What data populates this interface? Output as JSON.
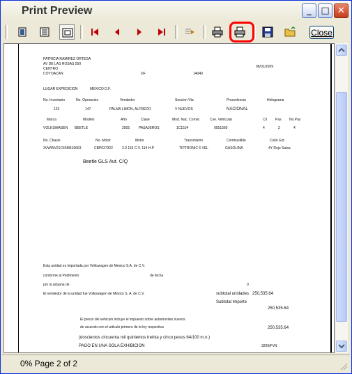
{
  "window": {
    "title": "Print Preview",
    "minimize_glyph": "_",
    "maximize_glyph": "□",
    "close_glyph": "✕"
  },
  "toolbar": {
    "close_label": "Close",
    "buttons": [
      "one-page-view",
      "two-page-view",
      "fit-page",
      "first-page",
      "previous-page",
      "next-page",
      "last-page",
      "go-to-page",
      "printer-setup",
      "print",
      "save",
      "open"
    ]
  },
  "status": {
    "text": "0% Page 2 of 2"
  },
  "document": {
    "name": "PATRICIA RAMIREZ ORTEGA",
    "address1": "AV DE LAS ROSAS 550",
    "address2": "CENTRO",
    "address3": "COYOACAN",
    "state": "DF",
    "zip": "14040",
    "date": "06/01/2009",
    "lugar_label": "LUGAR EXPEDICION",
    "lugar_value": "MEXICO D.F.",
    "headers1": [
      "No. Inventario",
      "No. Operacion",
      "Vendedor",
      "Seccion Vta",
      "Procedencia",
      "Holograma"
    ],
    "values1": [
      "123",
      "147",
      "PALMA LIMON, ALFREDO",
      "V NUEVOS",
      "NACIONAL"
    ],
    "headers2": [
      "Marca",
      "Modelo",
      "Año",
      "Clase",
      "Mod. Nac. Comer.",
      "Cve. Vehicular",
      "Cil",
      "Pas",
      "No.Pas"
    ],
    "values2": [
      "VOLKSWAGEN",
      "BEETLE",
      "2005",
      "PASAJEROS",
      "1C15J4",
      "0051560",
      "4",
      "2",
      "4"
    ],
    "headers3": [
      "No. Chasis",
      "No. Motor",
      "Motor",
      "Transmisión",
      "Combustible",
      "Color Ext."
    ],
    "values3": [
      "3VWWV21C45M516663",
      "CBP037322",
      "2.0 115 C.V. 114 H.P",
      "TIPTRONIC 6 VEL",
      "GASOLINA",
      "4Y Rojo Salsa"
    ],
    "description": "Beetle GLS Aut. C/Q",
    "legal1": "Esta unidad es importada por Volkswagen de Mexico S.A. de C.V.",
    "legal2": "conforme al Pedimento",
    "legal2b": "de fecha",
    "legal3": "por la aduana de",
    "legal3b": "0",
    "legal4": "El vendedor de la unidad fue Volkswagen de Mexico S. A. de C.V.",
    "subtotal_label": "subtotal unidades",
    "subtotal_value": "250,535.64",
    "subtotal_imp_label": "Subtotal Importe",
    "subtotal_imp_value": "250,535.64",
    "iva1": "El precio del vehiculo incluye el impuesto sobre automoviles nuevos",
    "iva2": "de acuerdo con el articulo primero de la ley respectiva",
    "total_value": "250,535.64",
    "amount_words": "(doscientos cincuenta mil quinientos treinta y cinco pesos 64/100 m.n.)",
    "pago": "PAGO EN UNA SOLA EXHIBICION",
    "folio": "3209/FVN"
  }
}
